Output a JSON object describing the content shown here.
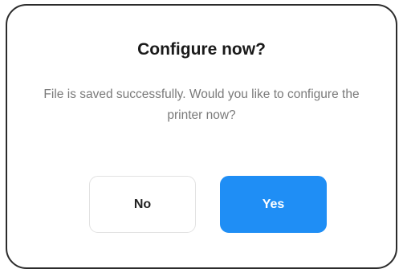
{
  "dialog": {
    "title": "Configure now?",
    "message": "File is saved successfully. Would you like to configure the printer now?",
    "buttons": {
      "no_label": "No",
      "yes_label": "Yes"
    }
  },
  "colors": {
    "primary": "#1f8ef5",
    "title_text": "#1a1a1a",
    "message_text": "#7a7a7a",
    "border": "#2b2b2b"
  }
}
